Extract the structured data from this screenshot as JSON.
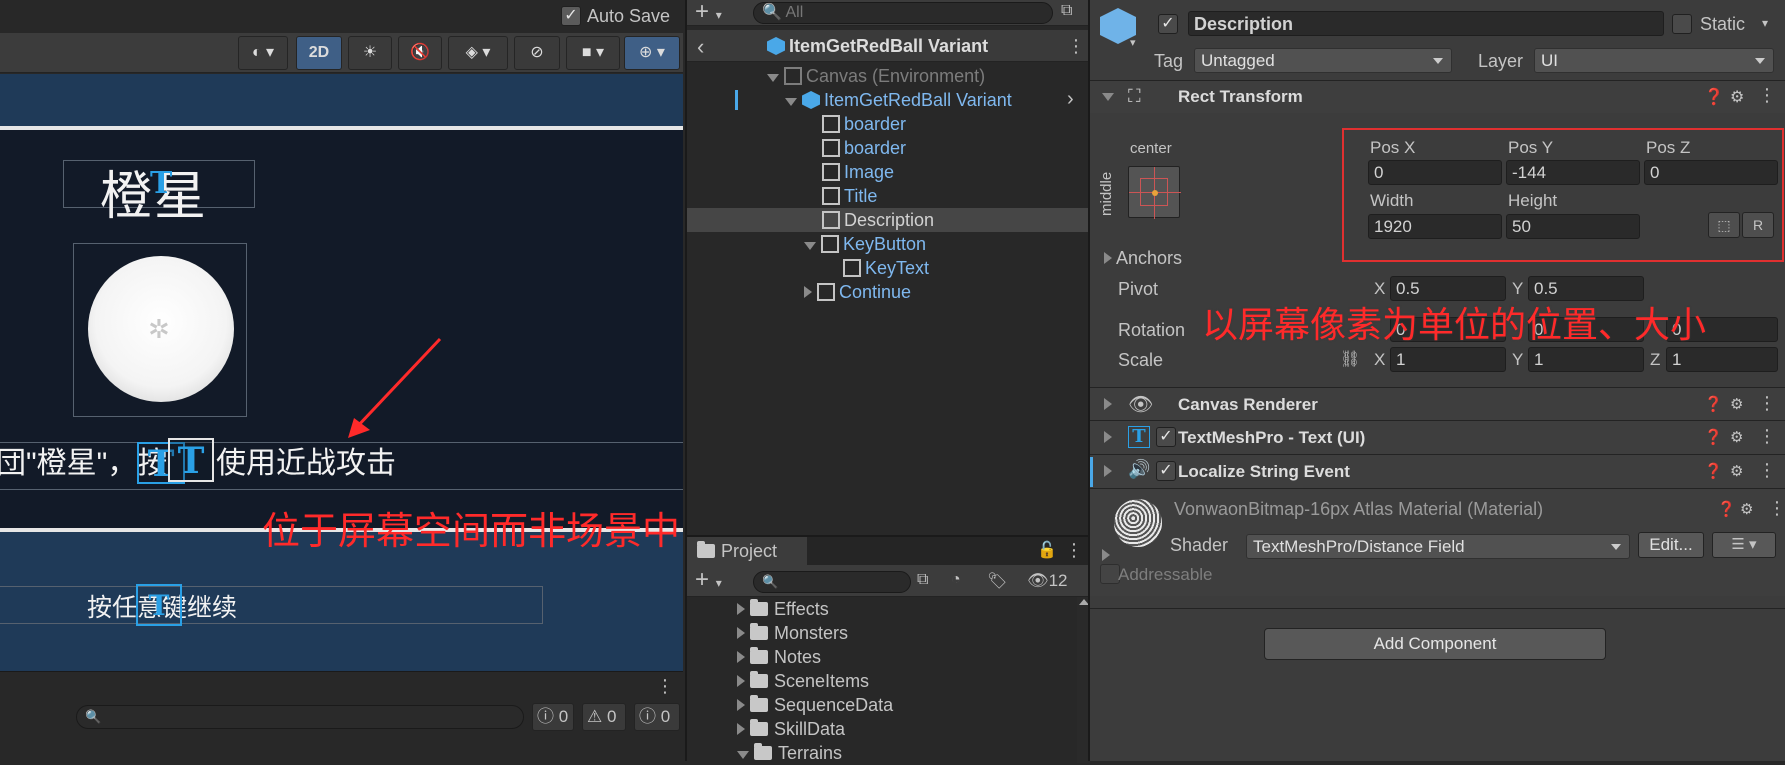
{
  "scene_view": {
    "auto_save_label": "Auto Save",
    "mode_2d": "2D",
    "title_text": "橙星",
    "description_text": "団\"橙星\"，按",
    "description_text_2": "使用近战攻击",
    "continue_text": "按任意键继续",
    "annotation_screen_space": "位于屏幕空间而非场景中",
    "console_counts": {
      "info": "0",
      "warn": "0",
      "error": "0"
    }
  },
  "hierarchy": {
    "search_placeholder": "All",
    "breadcrumb": "ItemGetRedBall Variant",
    "items": [
      {
        "label": "Canvas (Environment)"
      },
      {
        "label": "ItemGetRedBall Variant"
      },
      {
        "label": "boarder"
      },
      {
        "label": "boarder"
      },
      {
        "label": "Image"
      },
      {
        "label": "Title"
      },
      {
        "label": "Description"
      },
      {
        "label": "KeyButton"
      },
      {
        "label": "KeyText"
      },
      {
        "label": "Continue"
      }
    ]
  },
  "project": {
    "tab_label": "Project",
    "hidden_count": "12",
    "folders": [
      "Effects",
      "Monsters",
      "Notes",
      "SceneItems",
      "SequenceData",
      "SkillData",
      "Terrains"
    ]
  },
  "inspector": {
    "object_name": "Description",
    "static_label": "Static",
    "tag_label": "Tag",
    "tag_value": "Untagged",
    "layer_label": "Layer",
    "layer_value": "UI",
    "rect_transform": {
      "title": "Rect Transform",
      "anchor_h": "center",
      "anchor_v": "middle",
      "pos_x_label": "Pos X",
      "pos_y_label": "Pos Y",
      "pos_z_label": "Pos Z",
      "pos_x": "0",
      "pos_y": "-144",
      "pos_z": "0",
      "width_label": "Width",
      "height_label": "Height",
      "width": "1920",
      "height": "50",
      "anchors_label": "Anchors",
      "pivot_label": "Pivot",
      "pivot_x": "0.5",
      "pivot_y": "0.5",
      "rotation_label": "Rotation",
      "rot_x": "0",
      "rot_y": "0",
      "rot_z": "0",
      "scale_label": "Scale",
      "scale_x": "1",
      "scale_y": "1",
      "scale_z": "1",
      "x": "X",
      "y": "Y",
      "z": "Z"
    },
    "annotation_pixels": "以屏幕像素为单位的位置、大小",
    "components": [
      {
        "title": "Canvas Renderer"
      },
      {
        "title": "TextMeshPro - Text (UI)"
      },
      {
        "title": "Localize String Event"
      }
    ],
    "material": {
      "title": "VonwaonBitmap-16px Atlas Material (Material)",
      "shader_label": "Shader",
      "shader_value": "TextMeshPro/Distance Field",
      "edit_label": "Edit...",
      "addressable_label": "Addressable"
    },
    "add_component_label": "Add Component"
  }
}
